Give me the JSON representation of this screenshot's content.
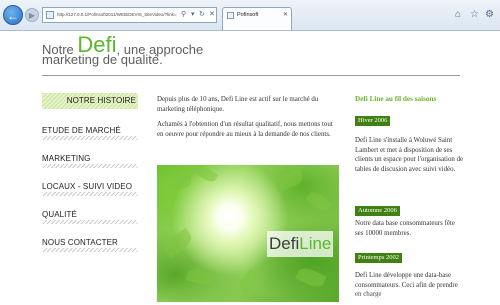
{
  "browser": {
    "url": "http://127.0.0.1/Pofinsoft2011/WEB/DEVIS_SiteVideo/?link=1",
    "tab_title": "Pofinsoft",
    "back_icon": "back-arrow-icon",
    "forward_icon": "forward-arrow-icon",
    "home_icon": "home-icon",
    "favorites_icon": "star-icon",
    "tools_icon": "gear-icon"
  },
  "header": {
    "line1_prefix": "Notre ",
    "brand": "Defi",
    "line1_suffix": ", une approche",
    "line2": "marketing de qualité."
  },
  "nav": {
    "items": [
      {
        "label": "NOTRE HISTOIRE",
        "active": true
      },
      {
        "label": "ETUDE DE MARCHÉ",
        "active": false
      },
      {
        "label": "MARKETING",
        "active": false
      },
      {
        "label": "LOCAUX - SUIVI VIDEO",
        "active": false
      },
      {
        "label": "QUALITÉ",
        "active": false
      },
      {
        "label": "NOUS CONTACTER",
        "active": false
      }
    ]
  },
  "main": {
    "paragraph1": "Depuis plus de 10 ans, Defi Line est actif sur le marché du marketing téléphonique.",
    "paragraph2": "Achamés à l'obtention d'un résultat qualitatif, nous mettons tout en oeuvre pour répondre au mieux à la demande de nos clients.",
    "logo_part1": "Defi",
    "logo_part2": "Line"
  },
  "sidebar": {
    "title": "Defi Line au fil des saisons",
    "entries": [
      {
        "season": "Hiver 2006",
        "text": "Defi Line s'installe à Woluwé Saint Lambert et met à disposition de ses clients un espace pour l'organisation de tables de discusion avec suivi vidéo."
      },
      {
        "season": "Automne 2006",
        "text": "Notre data base consommateurs fête ses 10000 membres."
      },
      {
        "season": "Printemps 2002",
        "text": "Defi Line développe une data-base consommateurs. Ceci afin de prendre en charge"
      }
    ]
  },
  "colors": {
    "accent_green": "#5bb731",
    "badge_green": "#3f8112",
    "title_green": "#6ab42d"
  }
}
